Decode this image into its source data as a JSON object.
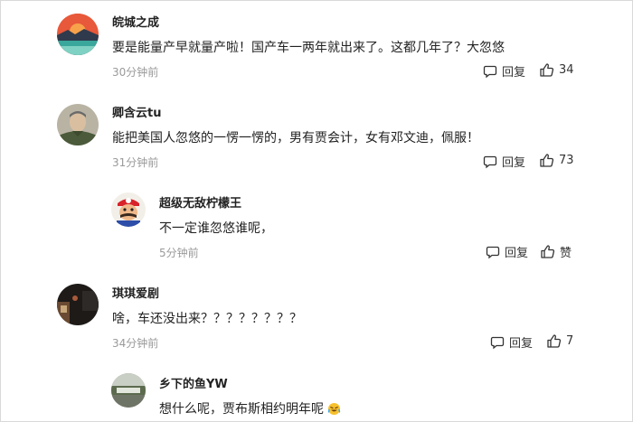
{
  "comments": [
    {
      "user": "皖城之成",
      "text": "要是能量产早就量产啦！国产车一两年就出来了。这都几年了？大忽悠",
      "time": "30分钟前",
      "reply_label": "回复",
      "likes": "34"
    },
    {
      "user": "卿含云tu",
      "text": "能把美国人忽悠的一愣一愣的，男有贾会计，女有邓文迪，佩服！",
      "time": "31分钟前",
      "reply_label": "回复",
      "likes": "73"
    },
    {
      "user": "超级无敌柠檬王",
      "text": "不一定谁忽悠谁呢，",
      "time": "5分钟前",
      "reply_label": "回复",
      "likes": "赞"
    },
    {
      "user": "琪琪爱剧",
      "text": "啥，车还没出来？？？？？？？？",
      "time": "34分钟前",
      "reply_label": "回复",
      "likes": "7"
    },
    {
      "user": "乡下的鱼YW",
      "text": "想什么呢，贾布斯相约明年呢",
      "time": "",
      "reply_label": "",
      "likes": ""
    }
  ],
  "icons": {
    "reply": "comment-icon",
    "like": "thumbs-up-icon",
    "emoji": "laughing-tears-emoji"
  }
}
